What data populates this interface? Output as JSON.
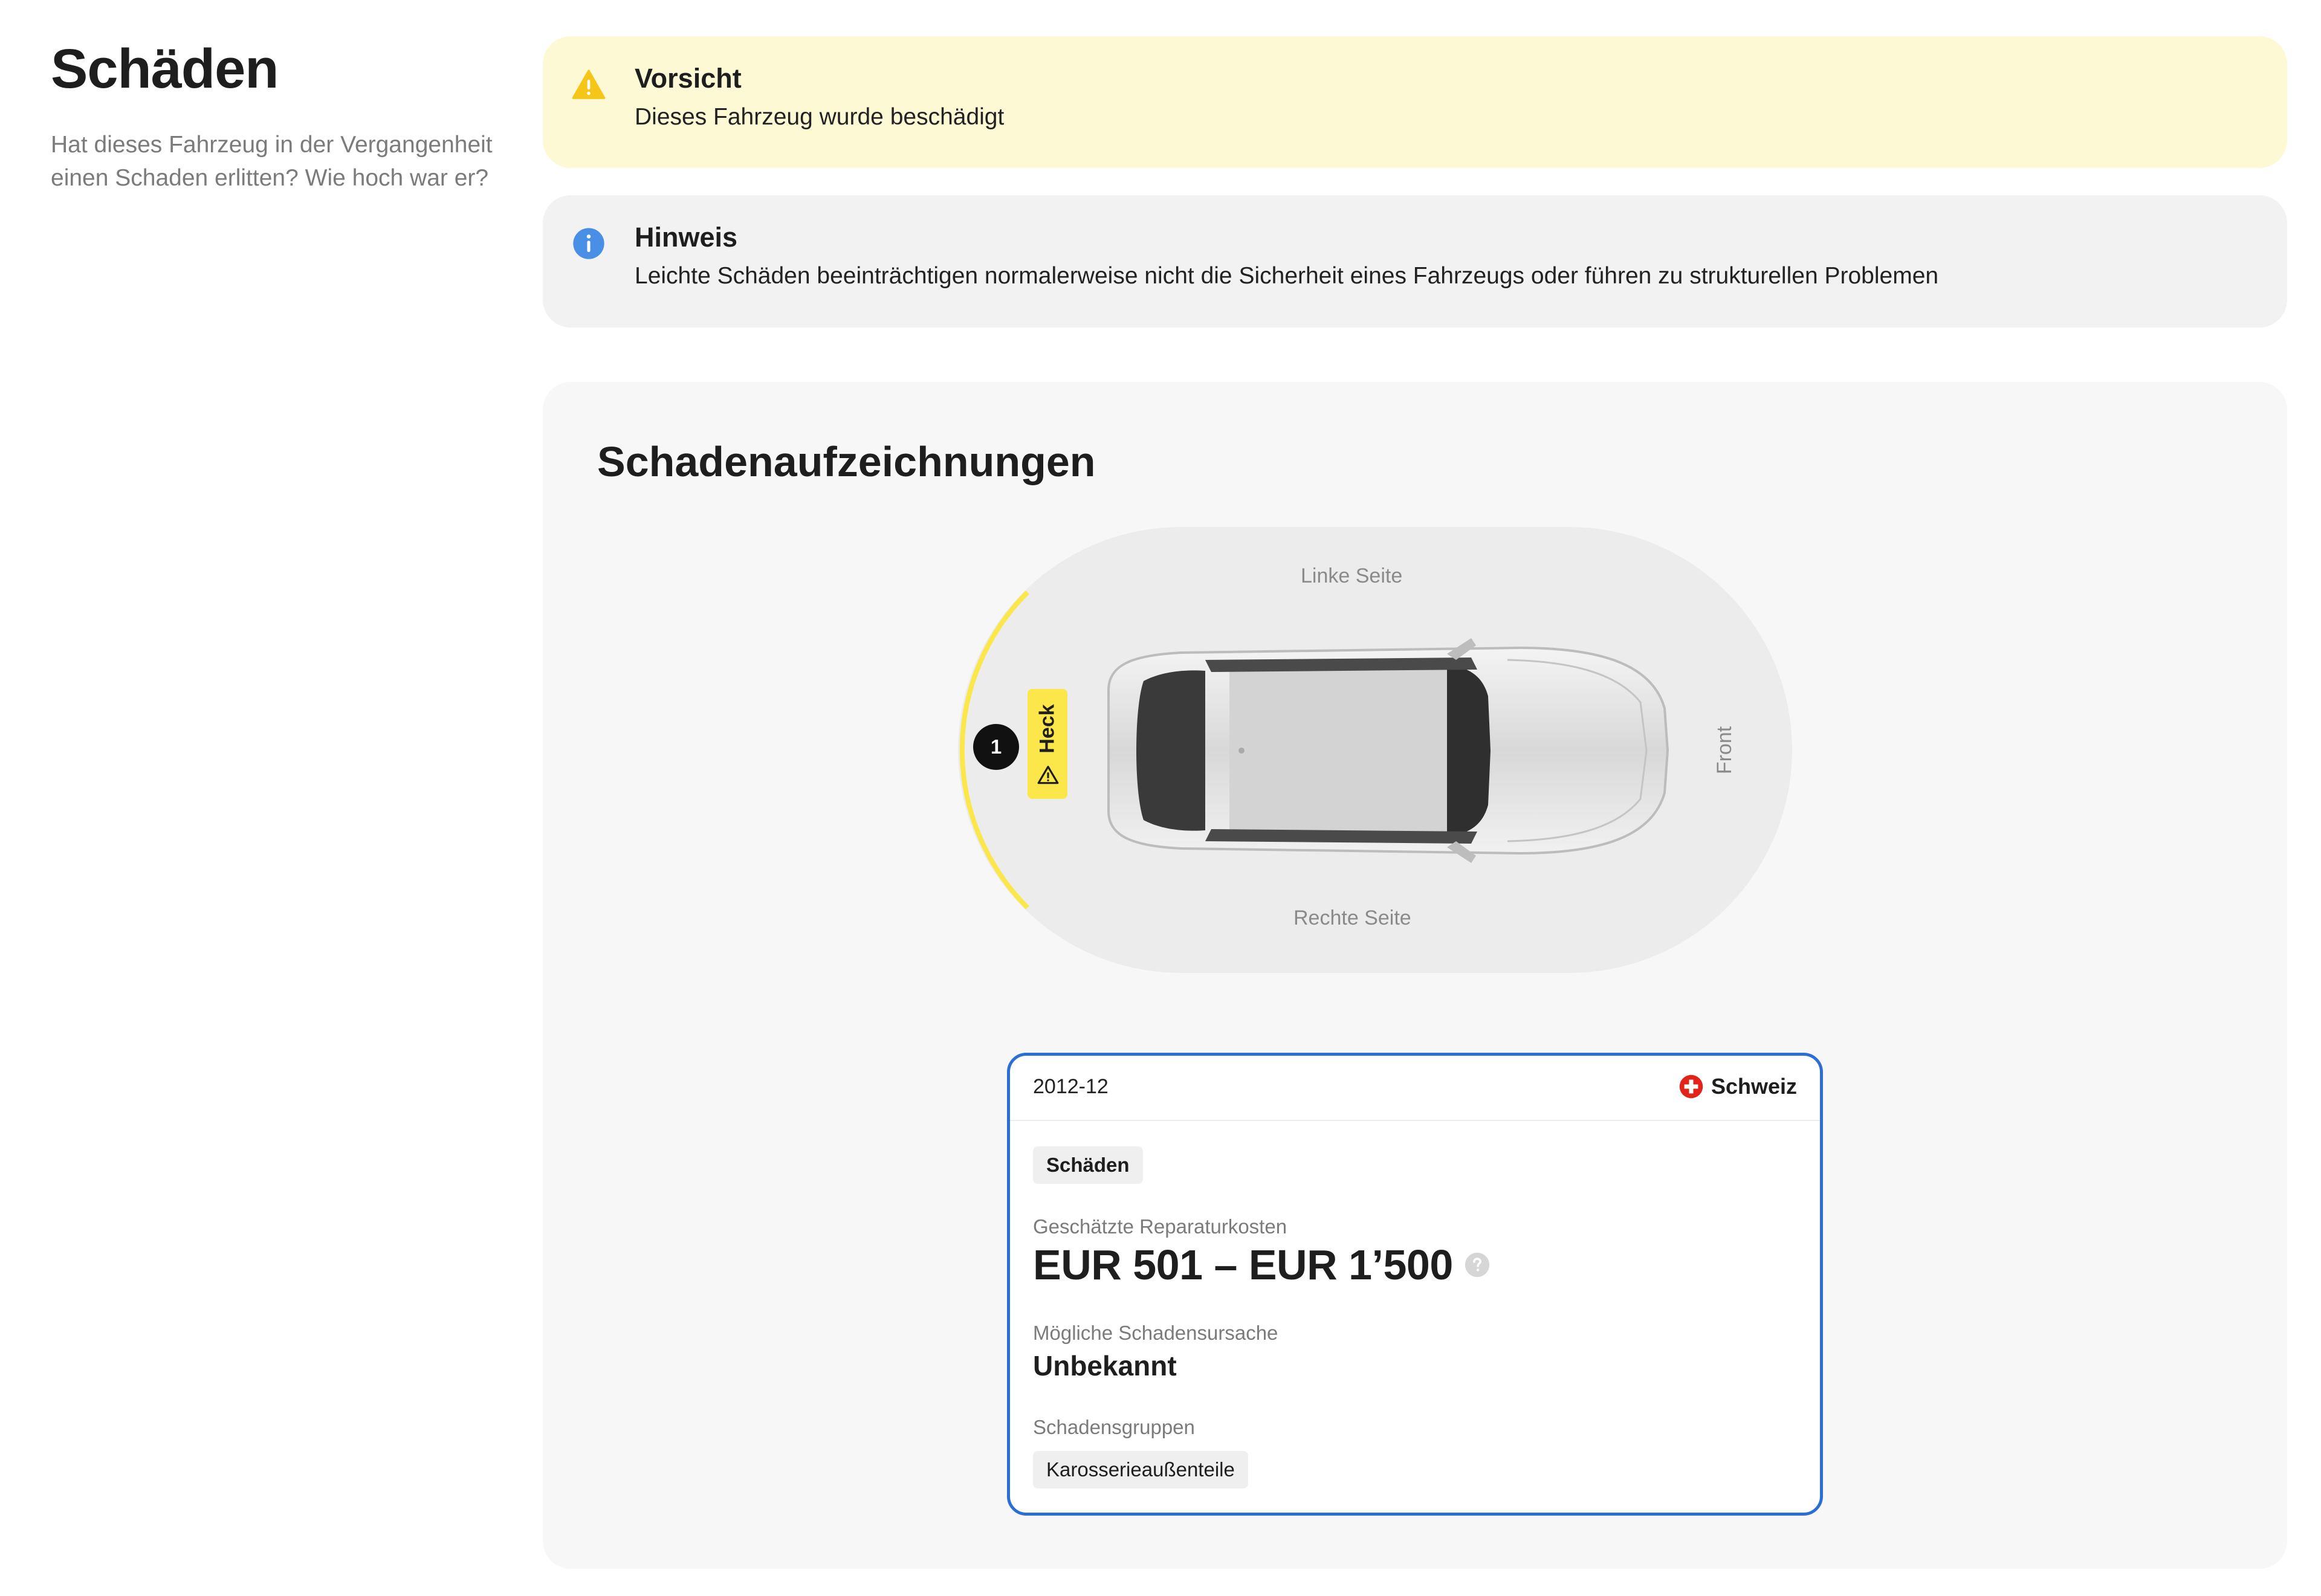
{
  "header": {
    "title": "Schäden",
    "subtitle": "Hat dieses Fahrzeug in der Vergangenheit einen Schaden erlitten? Wie hoch war er?"
  },
  "alerts": {
    "warning": {
      "title": "Vorsicht",
      "text": "Dieses Fahrzeug wurde beschädigt",
      "icon": "warning-icon",
      "color": "#fdf9d5"
    },
    "info": {
      "title": "Hinweis",
      "text": "Leichte Schäden beeinträchtigen normalerweise nicht die Sicherheit eines Fahrzeugs oder führen zu strukturellen Problemen",
      "icon": "info-icon",
      "color": "#f2f2f2"
    }
  },
  "records": {
    "title": "Schadenaufzeichnungen",
    "diagram": {
      "left_side": "Linke Seite",
      "right_side": "Rechte Seite",
      "front": "Front",
      "rear_tag": "Heck",
      "damage_count": "1",
      "highlight_color": "#fbe74a"
    },
    "card": {
      "date": "2012-12",
      "country": "Schweiz",
      "category": "Schäden",
      "cost_label": "Geschätzte Reparaturkosten",
      "cost_value": "EUR 501 – EUR 1’500",
      "cause_label": "Mögliche Schadensursache",
      "cause_value": "Unbekannt",
      "groups_label": "Schadensgruppen",
      "group": "Karosserieaußenteile",
      "border_color": "#2b6fd6"
    }
  }
}
